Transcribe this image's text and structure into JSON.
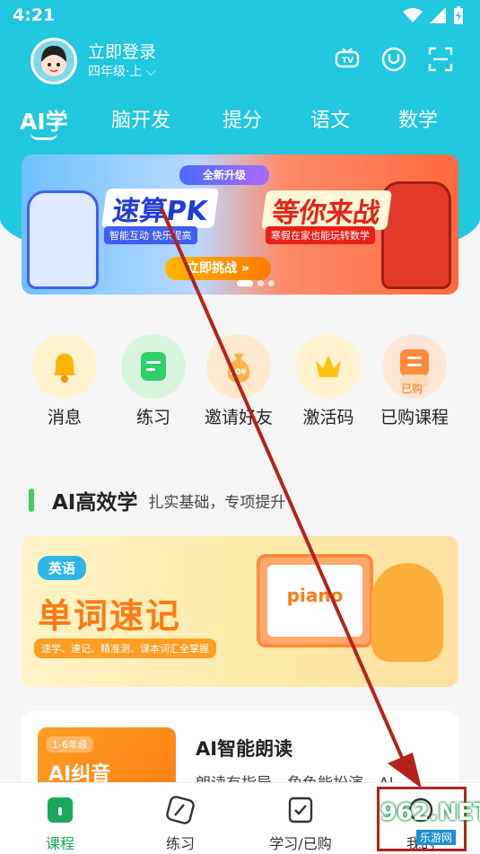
{
  "status": {
    "time": "4:21"
  },
  "user": {
    "name": "立即登录",
    "grade": "四年级·上"
  },
  "top_icons": [
    "tv-icon",
    "u-icon",
    "scan-icon"
  ],
  "tabs": [
    {
      "label": "AI学",
      "active": true
    },
    {
      "label": "脑开发"
    },
    {
      "label": "提分"
    },
    {
      "label": "语文"
    },
    {
      "label": "数学"
    }
  ],
  "banner": {
    "badge": "全新升级",
    "title1": "速算PK",
    "title2": "等你来战",
    "sub1": "智能互动 快乐提高",
    "sub2": "寒假在家也能玩转数学",
    "cta": "立即挑战 »"
  },
  "quick": [
    {
      "label": "消息",
      "icon": "bell-icon",
      "bg": "#fff2cc"
    },
    {
      "label": "练习",
      "icon": "practice-icon",
      "bg": "#d6f5dc"
    },
    {
      "label": "邀请好友",
      "icon": "money-bag-icon",
      "bg": "#ffe9cc"
    },
    {
      "label": "激活码",
      "icon": "crown-icon",
      "bg": "#fff2cc"
    },
    {
      "label": "已购课程",
      "icon": "course-icon",
      "bg": "#ffe6d6",
      "tag": "已购"
    }
  ],
  "section": {
    "title": "AI高效学",
    "subtitle": "扎实基础，专项提升"
  },
  "card1": {
    "pill": "英语",
    "title": "单词速记",
    "desc": "速学、速记、精准测、课本词汇全掌握",
    "board_word": "piano"
  },
  "card2": {
    "grade": "1-6年级",
    "thumb_title": "AI纠音",
    "title": "AI智能朗读",
    "desc": "朗读有指导，角色能扮演，AI"
  },
  "nav": [
    {
      "label": "课程",
      "icon": "course-tab-icon",
      "active": true
    },
    {
      "label": "练习",
      "icon": "pencil-icon"
    },
    {
      "label": "学习/已购",
      "icon": "check-doc-icon"
    },
    {
      "label": "我的",
      "icon": "profile-icon"
    }
  ],
  "watermark": {
    "main": "962.NET",
    "sub": "乐游网"
  },
  "colors": {
    "primary": "#21c6df",
    "green": "#17a85a",
    "annotation": "#b3231c"
  }
}
